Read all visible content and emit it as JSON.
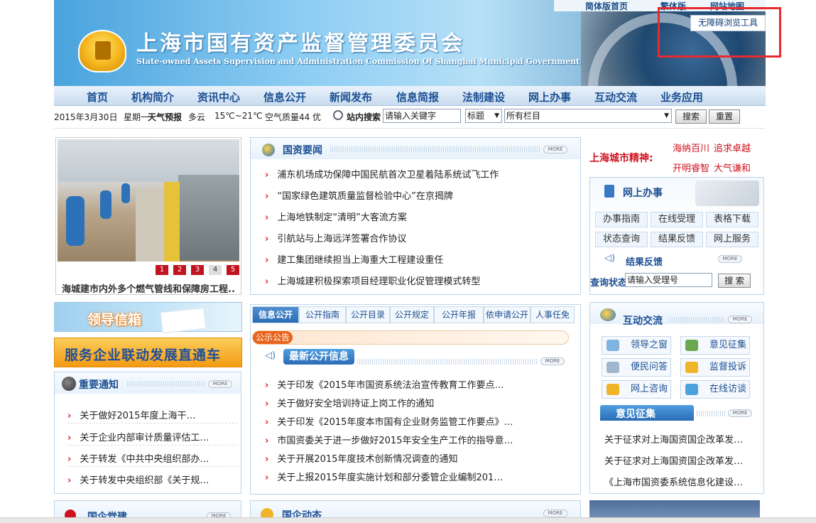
{
  "header": {
    "top_links": [
      "简体版首页",
      "繁体版",
      "网站地图"
    ],
    "title": "上海市国有资产监督管理委员会",
    "subtitle": "State-owned Assets Supervision and Administration Commission Of Shanghai Municipal Government",
    "a11y_button": "无障碍浏览工具"
  },
  "nav": [
    "首页",
    "机构简介",
    "资讯中心",
    "信息公开",
    "新闻发布",
    "信息简报",
    "法制建设",
    "网上办事",
    "互动交流",
    "业务应用"
  ],
  "infobar": {
    "date": "2015年3月30日",
    "weekday": "星期一",
    "weather_label": "天气预报",
    "weather": "多云",
    "temp": "15℃~21℃",
    "air": "空气质量44",
    "air_level": "优",
    "search_label": "站内搜索",
    "search_value": "请输入关键字",
    "scope": "标题",
    "column": "所有栏目",
    "search_btn": "搜索",
    "reset_btn": "重置"
  },
  "slideshow": {
    "pages": [
      "1",
      "2",
      "3",
      "4",
      "5"
    ],
    "caption": "海城建市内外多个燃气管线和保障房工程.."
  },
  "news": {
    "title": "国资要闻",
    "more": "MORE",
    "items": [
      "浦东机场成功保障中国民航首次卫星着陆系统试飞工作",
      "“国家绿色建筑质量监督检验中心”在京揭牌",
      "上海地铁制定“清明”大客流方案",
      "引航站与上海远洋签署合作协议",
      "建工集团继续担当上海重大工程建设重任",
      "上海城建积极探索项目经理职业化促管理模式转型"
    ]
  },
  "spirit": {
    "label": "上海城市精神:",
    "words": [
      "海纳百川",
      "追求卓越",
      "开明睿智",
      "大气谦和"
    ]
  },
  "online": {
    "title": "网上办事",
    "buttons": [
      "办事指南",
      "在线受理",
      "表格下载",
      "状态查询",
      "结果反馈",
      "网上服务"
    ],
    "result_title": "结果反馈",
    "more": "MORE",
    "query_label": "查询状态",
    "query_value": "请输入受理号",
    "query_btn": "搜 索"
  },
  "banners": {
    "leader": "领导信箱",
    "service": "服务企业联动发展直通车"
  },
  "notices": {
    "title": "重要通知",
    "more": "MORE",
    "items": [
      "关于做好2015年度上海干…",
      "关于企业内部审计质量评估工…",
      "关于转发《中共中央组织部办…",
      "关于转发中央组织部《关于规…"
    ]
  },
  "disclosure": {
    "tabs": [
      "信息公开",
      "公开指南",
      "公开目录",
      "公开规定",
      "公开年报",
      "依申请公开",
      "人事任免"
    ],
    "notice_tag": "公示公告",
    "latest_title": "最新公开信息",
    "more": "MORE",
    "items": [
      "关于印发《2015年市国资系统法治宣传教育工作要点…",
      "关于做好安全培训持证上岗工作的通知",
      "关于印发《2015年度本市国有企业财务监管工作要点》…",
      "市国资委关于进一步做好2015年安全生产工作的指导意…",
      "关于开展2015年度技术创新情况调查的通知",
      "关于上报2015年度实施计划和部分委管企业编制201…"
    ]
  },
  "interact": {
    "title": "互动交流",
    "more": "MORE",
    "buttons": [
      "领导之窗",
      "意见征集",
      "便民问答",
      "监督投诉",
      "网上咨询",
      "在线访谈"
    ],
    "opinion_title": "意见征集",
    "opinion_items": [
      "关于征求对上海国资国企改革发…",
      "关于征求对上海国资国企改革发…",
      "《上海市国资委系统信息化建设…"
    ]
  },
  "bottom": {
    "party": "国企党建",
    "dynamics": "国企动态",
    "more": "MORE"
  }
}
